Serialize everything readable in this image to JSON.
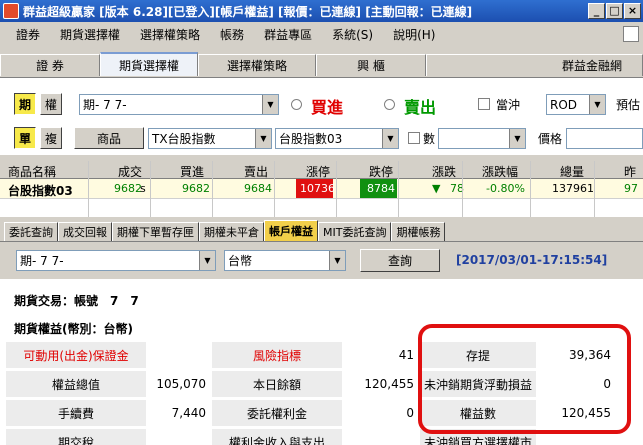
{
  "window": {
    "title": "群益超級贏家 [版本 6.28][已登入][帳戶權益] [報價：已連線] [主動回報：已連線]",
    "buttons": [
      "_",
      "□",
      "×"
    ]
  },
  "menu": {
    "items": [
      "證券",
      "期貨選擇權",
      "選擇權策略",
      "帳務",
      "群益專區",
      "系統(S)",
      "說明(H)"
    ]
  },
  "top_tabs": {
    "items": [
      "證 券",
      "期貨選擇權",
      "選擇權策略",
      "興 櫃",
      "群益金融網"
    ],
    "active": "期貨選擇權"
  },
  "order": {
    "futures_btn": "期",
    "options_btn": "權",
    "account_value": "期-  7  7-",
    "buy_label": "買進",
    "sell_label": "賣出",
    "daytrade_label": "當沖",
    "rod_value": "ROD",
    "preset_label": "預估",
    "single_btn": "單",
    "multi_btn": "複",
    "product_btn": "商品",
    "product_value": "TX台股指數",
    "contract_value": "台股指數03",
    "qty_label": "數",
    "price_label": "價格"
  },
  "quote": {
    "headers": [
      "商品名稱",
      "成交",
      "買進",
      "賣出",
      "漲停",
      "跌停",
      "漲跌",
      "漲跌幅",
      "總量",
      "昨"
    ],
    "row": {
      "name": "台股指數03",
      "last": "9682",
      "last_flag": "s",
      "bid": "9682",
      "ask": "9684",
      "limit_up": "10736",
      "limit_down": "8784",
      "change": "78",
      "change_pct": "-0.80%",
      "volume": "137961",
      "prev": "97"
    },
    "colors": {
      "limit_up_bg": "#e01010",
      "limit_down_bg": "#109010",
      "value": "#008000"
    }
  },
  "bottom_tabs": {
    "items": [
      "委託查詢",
      "成交回報",
      "期權下單暫存匣",
      "期權未平倉",
      "帳戶權益",
      "MIT委託查詢",
      "期權帳務"
    ],
    "active": "帳戶權益"
  },
  "account": {
    "account_value": "期-  7  7-",
    "currency_value": "台幣",
    "query_btn": "查詢",
    "timestamp": "[2017/03/01-17:15:54]"
  },
  "content": {
    "futures_trade": "期貨交易：帳號　7　7",
    "equity_title": "期貨權益(幣別：台幣)",
    "rows": [
      [
        {
          "label": "可動用(出金)保證金",
          "value": "",
          "red": true
        },
        {
          "label": "風險指標",
          "value": "41",
          "red": true
        },
        {
          "label": "存提",
          "value": "39,364",
          "red": false
        }
      ],
      [
        {
          "label": "權益總值",
          "value": "105,070",
          "red": false
        },
        {
          "label": "本日餘額",
          "value": "120,455",
          "red": false
        },
        {
          "label": "未沖銷期貨浮動損益",
          "value": "0",
          "red": false
        }
      ],
      [
        {
          "label": "手續費",
          "value": "7,440",
          "red": false
        },
        {
          "label": "委託權利金",
          "value": "0",
          "red": false
        },
        {
          "label": "權益數",
          "value": "120,455",
          "red": false
        }
      ],
      [
        {
          "label": "期交稅",
          "value": "",
          "red": false
        },
        {
          "label": "權利金收入與支出",
          "value": "",
          "red": false
        },
        {
          "label": "未沖銷買方選擇權市",
          "value": "",
          "red": false
        }
      ]
    ]
  }
}
